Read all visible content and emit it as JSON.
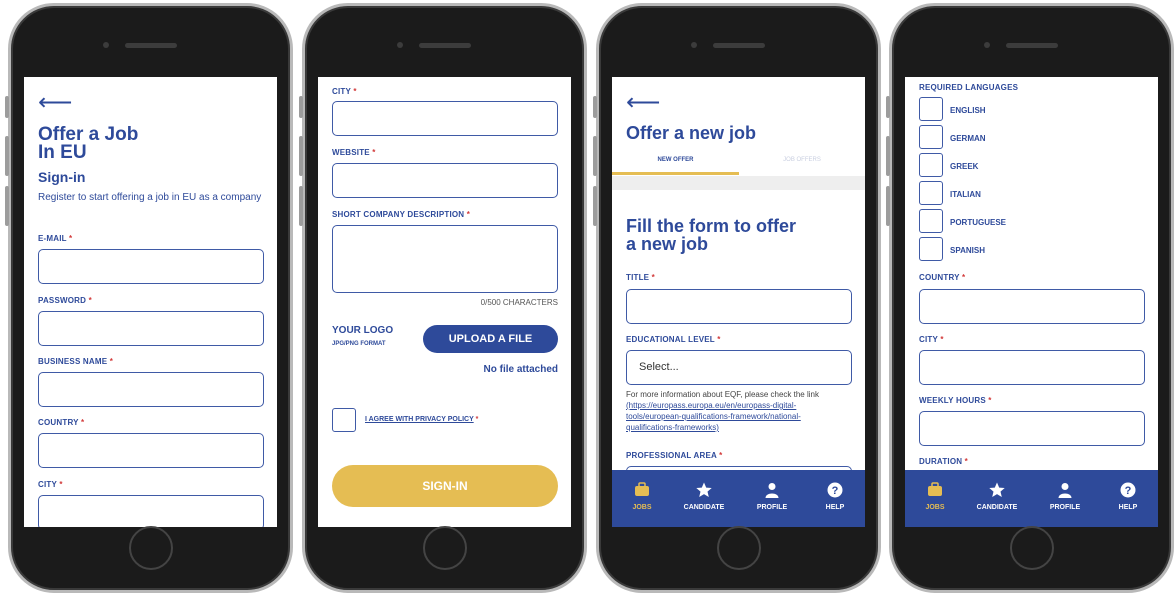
{
  "screen1": {
    "back": "⟵",
    "title_line1": "Offer a Job",
    "title_line2": "In EU",
    "subtitle": "Sign-in",
    "description": "Register to start offering a job in EU as a company",
    "fields": [
      {
        "label": "E-MAIL",
        "req": "*"
      },
      {
        "label": "PASSWORD",
        "req": "*"
      },
      {
        "label": "BUSINESS NAME",
        "req": "*"
      },
      {
        "label": "COUNTRY",
        "req": "*"
      },
      {
        "label": "CITY",
        "req": "*"
      }
    ]
  },
  "screen2": {
    "fields": [
      {
        "label": "CITY",
        "req": "*"
      },
      {
        "label": "WEBSITE",
        "req": "*"
      },
      {
        "label": "SHORT COMPANY DESCRIPTION",
        "req": "*"
      }
    ],
    "char_count": "0/500 CHARACTERS",
    "logo_label": "YOUR LOGO",
    "logo_format": "JPG/PNG FORMAT",
    "upload_button": "UPLOAD A FILE",
    "no_file": "No file attached",
    "privacy_label": "I AGREE WITH PRIVACY POLICY",
    "privacy_req": "*",
    "signin_button": "SIGN-IN"
  },
  "screen3": {
    "back": "⟵",
    "title": "Offer a new job",
    "tabs": [
      "NEW OFFER",
      "JOB OFFERS"
    ],
    "form_title_line1": "Fill the form to offer",
    "form_title_line2": "a new job",
    "title_label": "TITLE",
    "edu_label": "EDUCATIONAL LEVEL",
    "req": "*",
    "edu_select": "Select...",
    "eqf_info": "For more information about EQF, please check the link",
    "eqf_link_1": "(https://europass.europa.eu/en/europass-digital-",
    "eqf_link_2": "tools/european-qualifications-framework/national-",
    "eqf_link_3": "qualifications-frameworks)",
    "area_label": "PROFESSIONAL AREA"
  },
  "screen4": {
    "languages_label": "REQUIRED LANGUAGES",
    "languages": [
      "ENGLISH",
      "GERMAN",
      "GREEK",
      "ITALIAN",
      "PORTUGUESE",
      "SPANISH"
    ],
    "fields": [
      {
        "label": "COUNTRY",
        "req": "*"
      },
      {
        "label": "CITY",
        "req": "*"
      },
      {
        "label": "WEEKLY HOURS",
        "req": "*"
      },
      {
        "label": "DURATION",
        "req": "*"
      }
    ]
  },
  "tabbar": {
    "items": [
      {
        "label": "JOBS",
        "icon": "briefcase-icon"
      },
      {
        "label": "CANDIDATE",
        "icon": "star-icon"
      },
      {
        "label": "PROFILE",
        "icon": "person-icon"
      },
      {
        "label": "HELP",
        "icon": "help-icon"
      }
    ]
  },
  "colors": {
    "brand": "#2e4a9a",
    "accent": "#e5bd53",
    "required": "#d23a3a"
  }
}
